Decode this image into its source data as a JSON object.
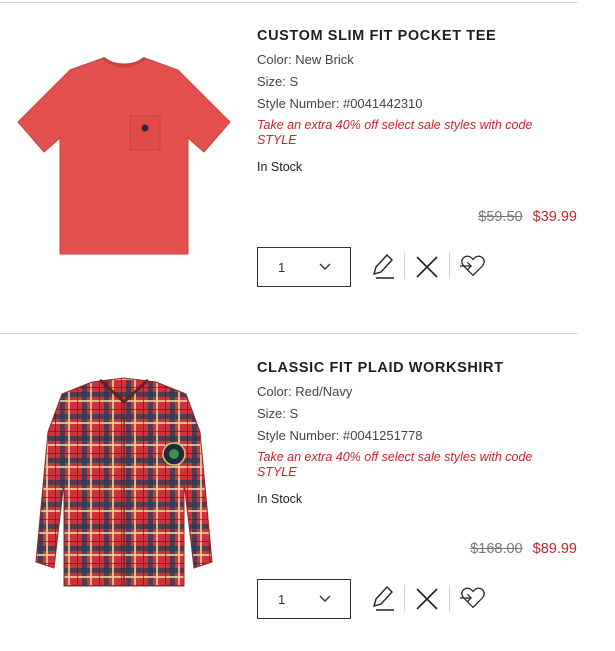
{
  "items": [
    {
      "name": "CUSTOM SLIM FIT POCKET TEE",
      "color": "Color: New Brick",
      "size": "Size: S",
      "style_number": "Style Number: #0041442310",
      "promo": "Take an extra 40% off select sale styles with code STYLE",
      "stock": "In Stock",
      "original_price": "$59.50",
      "sale_price": "$39.99",
      "quantity": "1",
      "image_icon": "red-pocket-tee-image"
    },
    {
      "name": "CLASSIC FIT PLAID WORKSHIRT",
      "color": "Color: Red/Navy",
      "size": "Size: S",
      "style_number": "Style Number: #0041251778",
      "promo": "Take an extra 40% off select sale styles with code STYLE",
      "stock": "In Stock",
      "original_price": "$168.00",
      "sale_price": "$89.99",
      "quantity": "1",
      "image_icon": "red-plaid-workshirt-image"
    }
  ],
  "icons": {
    "edit": "pencil-icon",
    "remove": "close-icon",
    "wishlist": "move-to-wishlist-heart-icon",
    "dropdown": "chevron-down-icon"
  },
  "colors": {
    "sale_red": "#c0272d",
    "tee_red": "#e4504d",
    "plaid_red": "#d0333a"
  }
}
